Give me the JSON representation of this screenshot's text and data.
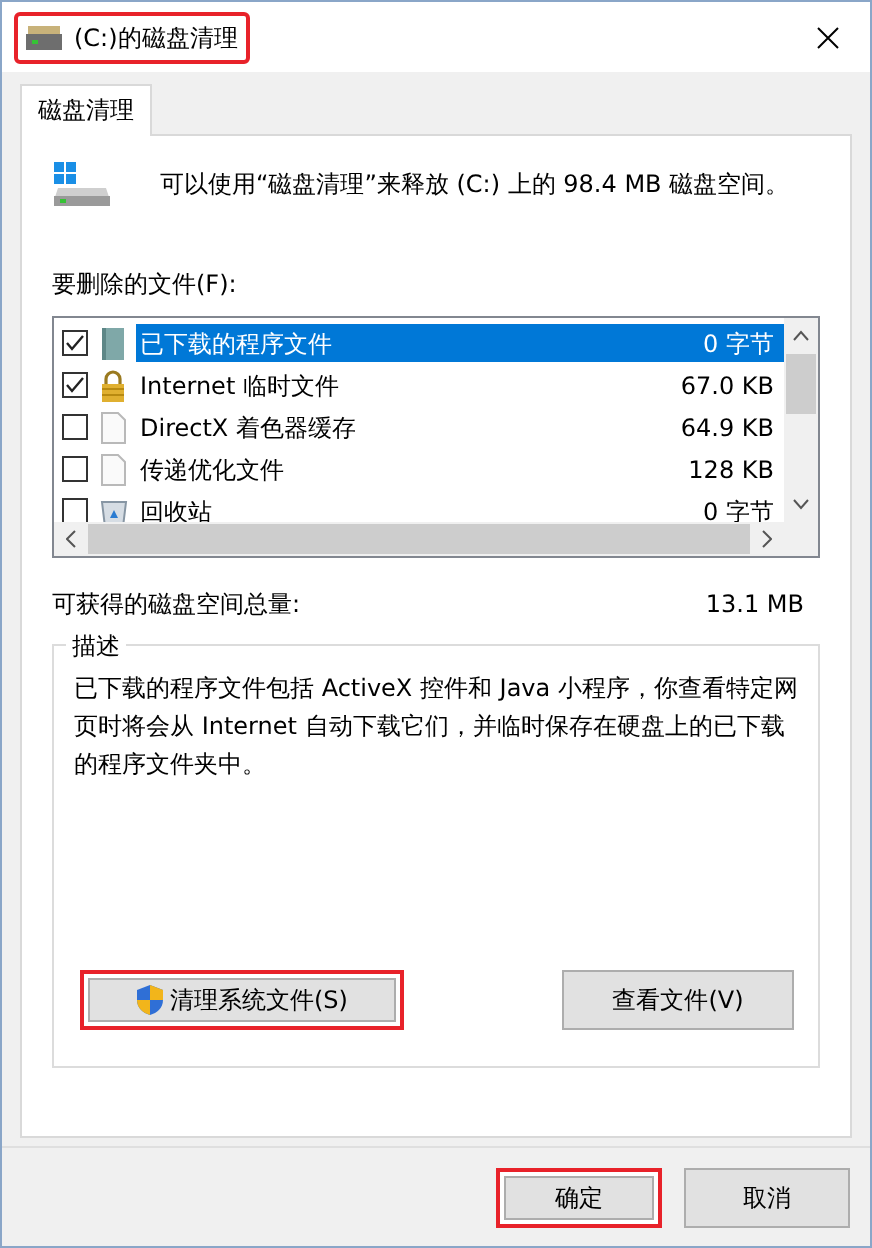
{
  "window": {
    "title": "(C:)的磁盘清理",
    "highlighted": true
  },
  "tabs": [
    {
      "label": "磁盘清理",
      "selected": true
    }
  ],
  "intro": "可以使用“磁盘清理”来释放  (C:) 上的 98.4 MB 磁盘空间。",
  "files_label": "要删除的文件(F):",
  "files": [
    {
      "kind": "downloaded",
      "name": "已下载的程序文件",
      "size": "0 字节",
      "checked": true,
      "selected": true
    },
    {
      "kind": "secured",
      "name": "Internet 临时文件",
      "size": "67.0 KB",
      "checked": true,
      "selected": false
    },
    {
      "kind": "file",
      "name": "DirectX 着色器缓存",
      "size": "64.9 KB",
      "checked": false,
      "selected": false
    },
    {
      "kind": "file",
      "name": "传递优化文件",
      "size": "128 KB",
      "checked": false,
      "selected": false
    },
    {
      "kind": "recycle",
      "name": "回收站",
      "size": "0 字节",
      "checked": false,
      "selected": false
    }
  ],
  "total": {
    "label": "可获得的磁盘空间总量:",
    "value": "13.1 MB"
  },
  "description": {
    "title": "描述",
    "text": "已下载的程序文件包括 ActiveX 控件和 Java 小程序，你查看特定网页时将会从 Internet 自动下载它们，并临时保存在硬盘上的已下载的程序文件夹中。"
  },
  "actions": [
    {
      "kind": "shield",
      "label": "清理系统文件(S)",
      "highlighted": true
    },
    {
      "kind": "plain",
      "label": "查看文件(V)",
      "highlighted": false
    }
  ],
  "buttons": [
    {
      "label": "确定",
      "highlighted": true
    },
    {
      "label": "取消",
      "highlighted": false
    }
  ]
}
